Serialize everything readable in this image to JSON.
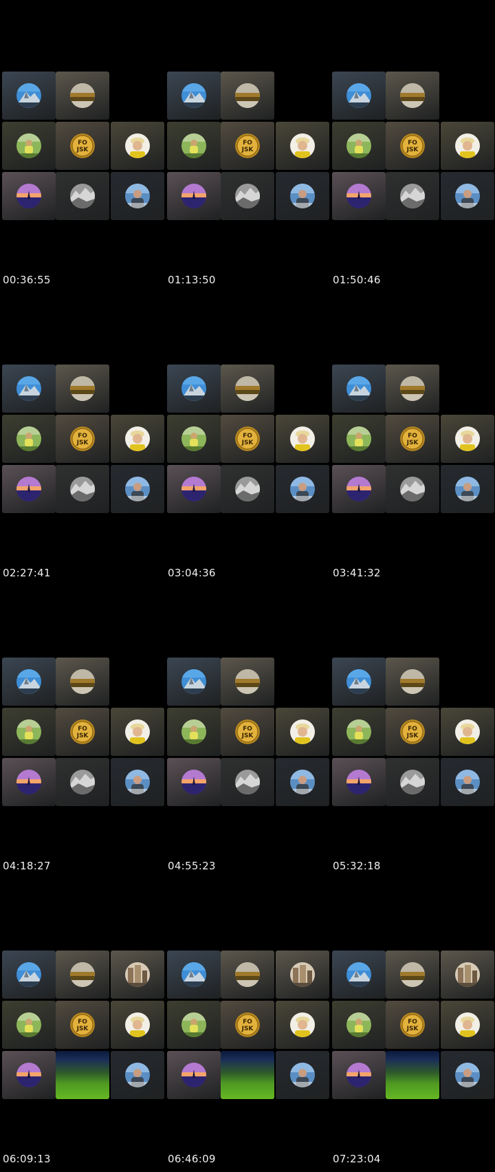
{
  "timestamps": [
    "00:36:55",
    "01:13:50",
    "01:50:46",
    "02:27:41",
    "03:04:36",
    "03:41:32",
    "04:18:27",
    "04:55:23",
    "05:32:18",
    "06:09:13",
    "06:46:09",
    "07:23:04"
  ],
  "logo_text": [
    "FO",
    "JSK"
  ],
  "tile_colors": {
    "blue": "#3b4653",
    "brown": "#5c574c",
    "olive": "#3d3e30",
    "gold": "#524b3f",
    "khaki": "#4a4738",
    "mauve": "#5a5055",
    "grey": "#2f3131",
    "slate": "#262a30"
  },
  "layouts": {
    "early": [
      [
        "mountain",
        "landscape",
        null
      ],
      [
        "cyclist",
        "logo",
        "hat"
      ],
      [
        "sunset",
        "mono",
        "selfie"
      ]
    ],
    "late": [
      [
        "mountain",
        "landscape",
        "city"
      ],
      [
        "cyclist",
        "logo",
        "hat"
      ],
      [
        "sunset",
        "video",
        "selfie"
      ]
    ]
  }
}
